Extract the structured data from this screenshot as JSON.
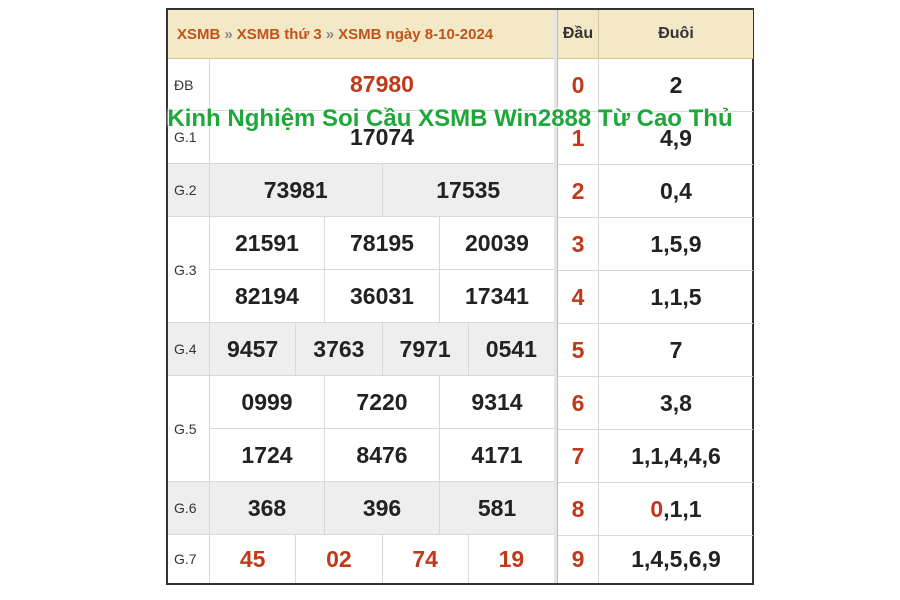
{
  "breadcrumb": {
    "part1": "XSMB",
    "sep": "»",
    "part2": "XSMB thứ 3",
    "part3": "XSMB ngày 8-10-2024"
  },
  "left_rows": [
    {
      "label": "ĐB",
      "lines": [
        [
          "87980"
        ]
      ],
      "red": true
    },
    {
      "label": "G.1",
      "lines": [
        [
          "17074"
        ]
      ]
    },
    {
      "label": "G.2",
      "lines": [
        [
          "73981",
          "17535"
        ]
      ]
    },
    {
      "label": "G.3",
      "lines": [
        [
          "21591",
          "78195",
          "20039"
        ],
        [
          "82194",
          "36031",
          "17341"
        ]
      ]
    },
    {
      "label": "G.4",
      "lines": [
        [
          "9457",
          "3763",
          "7971",
          "0541"
        ]
      ]
    },
    {
      "label": "G.5",
      "lines": [
        [
          "0999",
          "7220",
          "9314"
        ],
        [
          "1724",
          "8476",
          "4171"
        ]
      ]
    },
    {
      "label": "G.6",
      "lines": [
        [
          "368",
          "396",
          "581"
        ]
      ]
    },
    {
      "label": "G.7",
      "lines": [
        [
          "45",
          "02",
          "74",
          "19"
        ]
      ],
      "red": true
    }
  ],
  "right_table": {
    "header_dau": "Đầu",
    "header_duoi": "Đuôi",
    "rows": [
      {
        "dau": "0",
        "duoi": "2"
      },
      {
        "dau": "1",
        "duoi": "4,9"
      },
      {
        "dau": "2",
        "duoi": "0,4"
      },
      {
        "dau": "3",
        "duoi": "1,5,9"
      },
      {
        "dau": "4",
        "duoi": "1,1,5"
      },
      {
        "dau": "5",
        "duoi": "7"
      },
      {
        "dau": "6",
        "duoi": "3,8"
      },
      {
        "dau": "7",
        "duoi": "1,1,4,4,6"
      },
      {
        "dau": "8",
        "duoi_red": "0",
        "duoi_rest": ",1,1"
      },
      {
        "dau": "9",
        "duoi": "1,4,5,6,9"
      }
    ]
  },
  "overlay_title": "Kinh Nghiệm Soi Cầu XSMB Win2888 Từ Cao Thủ",
  "colors": {
    "accent_red": "#c0391a",
    "header_bg": "#f4e9c6",
    "overlay_green": "#1fa83a"
  }
}
